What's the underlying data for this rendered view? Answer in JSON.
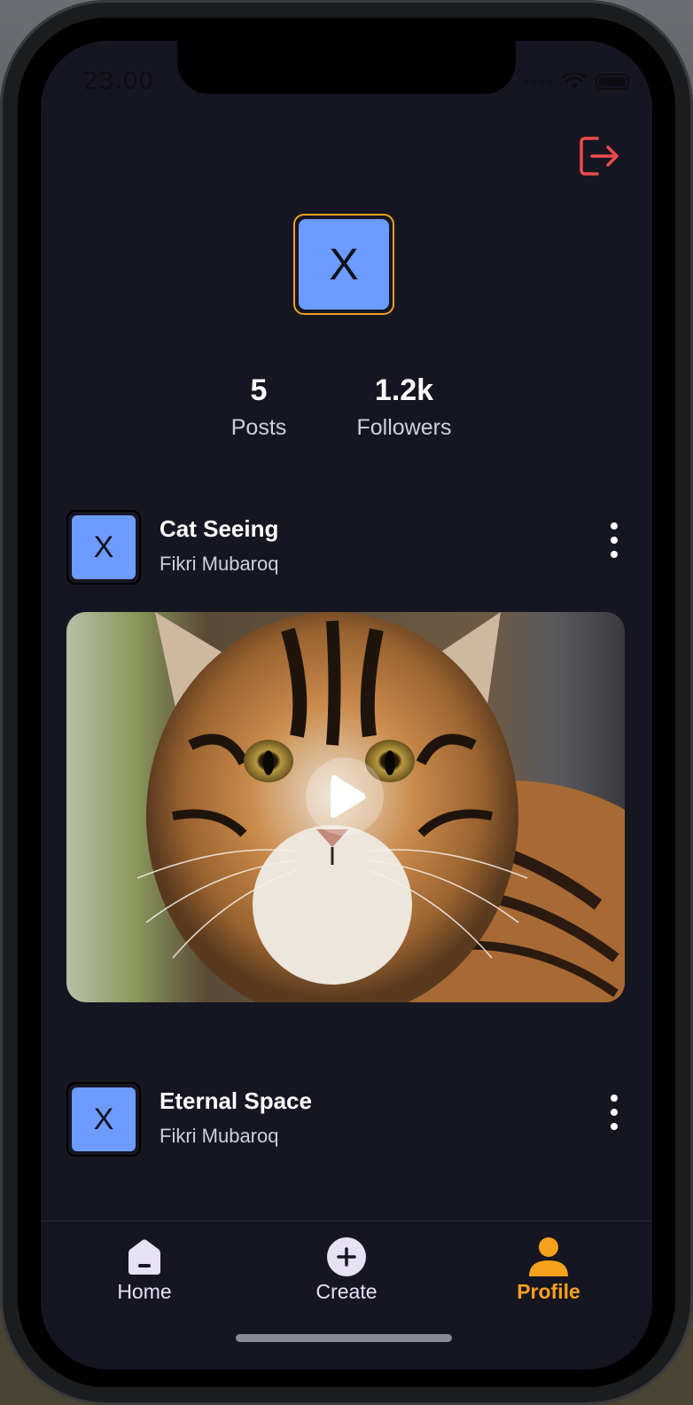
{
  "status_bar": {
    "time": "23.00"
  },
  "profile": {
    "avatar_letter": "X",
    "stats": [
      {
        "value": "5",
        "label": "Posts"
      },
      {
        "value": "1.2k",
        "label": "Followers"
      }
    ]
  },
  "posts": [
    {
      "avatar_letter": "X",
      "title": "Cat Seeing",
      "author": "Fikri Mubaroq"
    },
    {
      "avatar_letter": "X",
      "title": "Eternal Space",
      "author": "Fikri Mubaroq"
    }
  ],
  "nav": {
    "items": [
      {
        "label": "Home",
        "icon": "home-icon",
        "active": false
      },
      {
        "label": "Create",
        "icon": "plus-circle-icon",
        "active": false
      },
      {
        "label": "Profile",
        "icon": "person-icon",
        "active": true
      }
    ]
  },
  "colors": {
    "background": "#161623",
    "accent": "#f6a11b",
    "avatar": "#6e9bff",
    "logout": "#ef4b4b",
    "nav_inactive": "#e6e2f2"
  }
}
